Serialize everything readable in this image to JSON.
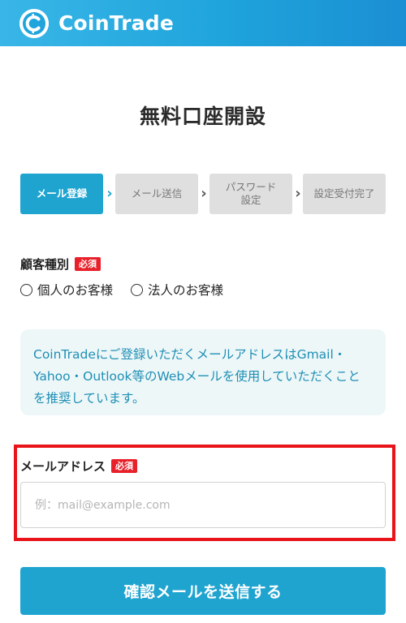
{
  "header": {
    "logo_icon": "coin-c-logo",
    "app_name": "CoinTrade",
    "brand_color": "#1fa4dc"
  },
  "page_title": "無料口座開設",
  "steps": [
    {
      "label": "メール登録",
      "active": true
    },
    {
      "label": "メール送信",
      "active": false
    },
    {
      "label": "パスワード\n設定",
      "active": false
    },
    {
      "label": "設定受付完了",
      "active": false
    }
  ],
  "step_arrow_icon": "chevron-right-icon",
  "customer_type": {
    "label": "顧客種別",
    "required_badge": "必須",
    "options": [
      "個人のお客様",
      "法人のお客様"
    ]
  },
  "notice": {
    "text": "CoinTradeにご登録いただくメールアドレスはGmail・Yahoo・Outlook等のWebメールを使用していただくことを推奨しています。"
  },
  "email": {
    "label": "メールアドレス",
    "required_badge": "必須",
    "placeholder": "例：mail@example.com",
    "value": ""
  },
  "submit_label": "確認メールを送信する",
  "colors": {
    "accent": "#1fa4d0",
    "required": "#e8202a",
    "highlight_border": "#e8141a",
    "step_inactive": "#dfdfdf"
  }
}
